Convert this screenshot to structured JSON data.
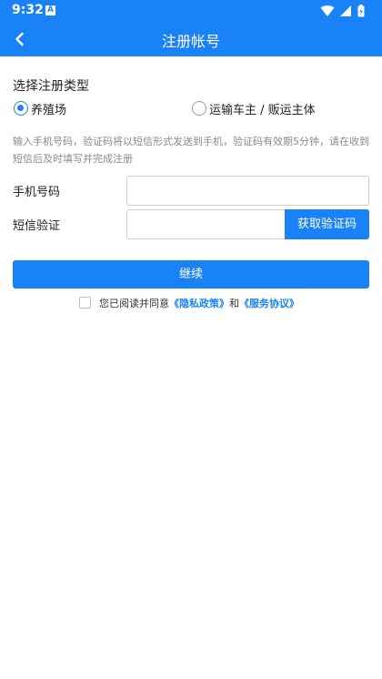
{
  "status_bar": {
    "time": "9:32",
    "notification_icon_letter": "A",
    "icons": [
      "wifi-icon",
      "signal-icon",
      "battery-icon"
    ]
  },
  "app_bar": {
    "title": "注册帐号",
    "back_icon": "chevron-left-icon"
  },
  "register_type": {
    "title": "选择注册类型",
    "options": [
      {
        "label": "养殖场",
        "selected": true
      },
      {
        "label": "运输车主 / 贩运主体",
        "selected": false
      }
    ]
  },
  "hint": "输入手机号码，验证码将以短信形式发送到手机，验证码有效期5分钟，请在收到短信后及时填写并完成注册",
  "form": {
    "phone_label": "手机号码",
    "phone_value": "",
    "sms_label": "短信验证",
    "sms_value": "",
    "sms_button": "获取验证码"
  },
  "continue_button": "继续",
  "agreement": {
    "checked": false,
    "prefix": "您已阅读并同意",
    "privacy_link": "《隐私政策》",
    "conjunction": "和",
    "service_link": "《服务协议》"
  },
  "colors": {
    "primary": "#1a82f7",
    "hint_text": "#8a8a8a",
    "border": "#cfcfcf"
  }
}
